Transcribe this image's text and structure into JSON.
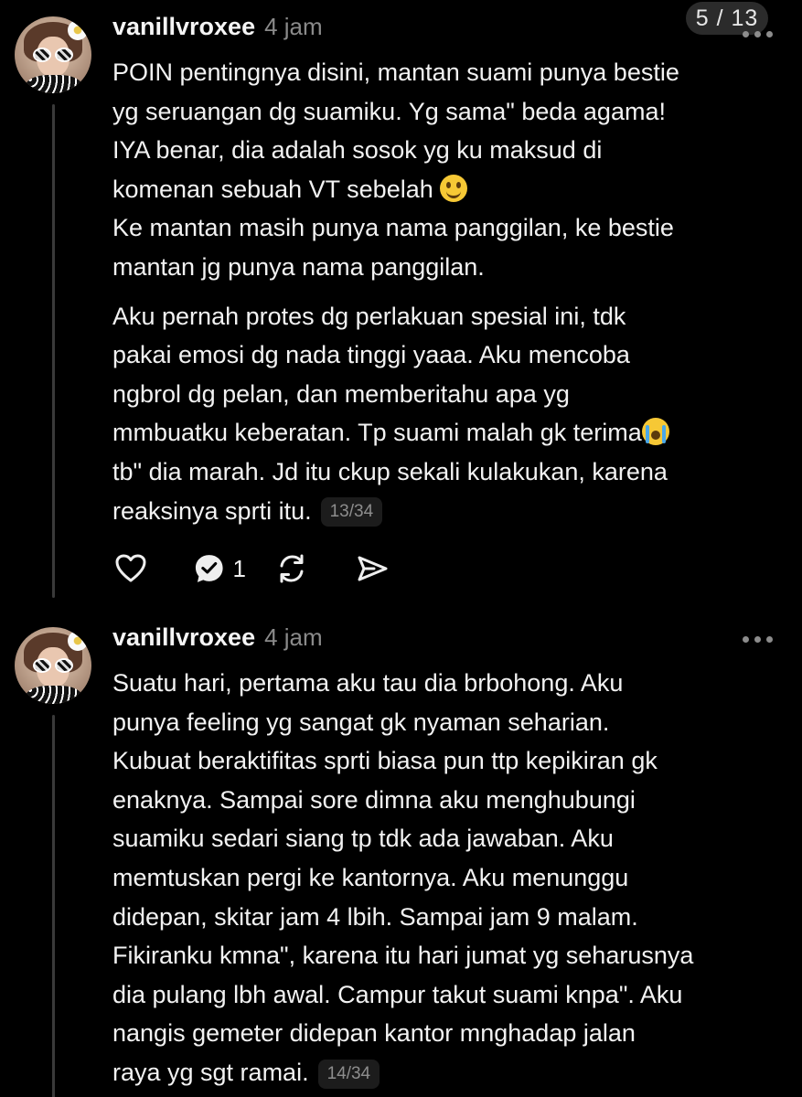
{
  "page_indicator": "5 / 13",
  "posts": [
    {
      "username": "vanillvroxee",
      "time": "4 jam",
      "lines_a": [
        "POIN pentingnya disini, mantan suami punya bestie",
        "yg seruangan dg suamiku. Yg sama\" beda agama!",
        "IYA benar, dia adalah sosok yg ku maksud di"
      ],
      "line_emoji": "komenan sebuah VT sebelah",
      "lines_b": [
        "Ke mantan masih punya nama panggilan, ke bestie",
        "mantan jg punya nama panggilan."
      ],
      "lines_c": [
        "Aku pernah protes dg perlakuan spesial ini, tdk",
        "pakai emosi dg nada tinggi yaaa. Aku mencoba",
        "ngbrol dg pelan, dan memberitahu apa yg"
      ],
      "line_cry": "mmbuatku keberatan. Tp suami malah gk terima",
      "line_after_cry": "tb\" dia marah. Jd itu ckup sekali kulakukan, karena",
      "last_line": "reaksinya sprti itu.",
      "counter": "13/34",
      "reply_count": "1"
    },
    {
      "username": "vanillvroxee",
      "time": "4 jam",
      "lines": [
        "Suatu hari, pertama aku tau dia brbohong. Aku",
        "punya feeling yg sangat gk nyaman seharian.",
        "Kubuat beraktifitas sprti biasa pun ttp kepikiran gk",
        "enaknya. Sampai sore dimna aku menghubungi",
        "suamiku sedari siang tp tdk ada jawaban. Aku",
        "memtuskan pergi ke kantornya. Aku menunggu",
        "didepan, skitar jam 4 lbih. Sampai jam 9 malam.",
        "Fikiranku kmna\", karena itu hari jumat yg seharusnya",
        "dia pulang lbh awal. Campur takut suami knpa\". Aku",
        "nangis gemeter didepan kantor mnghadap jalan"
      ],
      "last_line": "raya yg sgt ramai.",
      "counter": "14/34"
    }
  ],
  "icons": {
    "like": "heart-icon",
    "reply": "comment-icon",
    "repost": "repost-icon",
    "share": "send-icon",
    "more": "more-dots-icon",
    "emoji_1": "smiling-face-emoji",
    "emoji_2": "loudly-crying-face-emoji"
  },
  "colors": {
    "background": "#000000",
    "text": "#f2f2f2",
    "muted": "#8a8a8a",
    "thread_line": "#3a3a3a"
  }
}
